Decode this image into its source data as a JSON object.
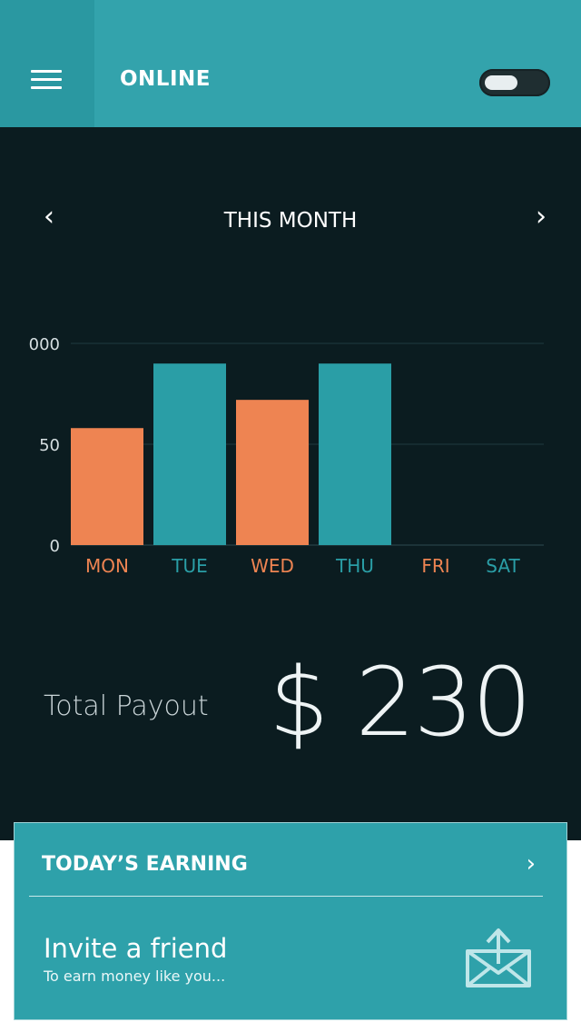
{
  "header": {
    "title": "ONLINE",
    "toggle_on": false
  },
  "period": {
    "title": "THIS MONTH"
  },
  "chart_data": {
    "type": "bar",
    "categories": [
      "MON",
      "TUE",
      "WED",
      "THU",
      "FRI",
      "SAT"
    ],
    "values": [
      58,
      90,
      72,
      90,
      0,
      0
    ],
    "bar_colors": [
      "#ee8452",
      "#2a9ea6",
      "#ee8452",
      "#2a9ea6",
      "#ee8452",
      "#2a9ea6"
    ],
    "ytick_labels": [
      "0",
      "50",
      "000"
    ],
    "ytick_values": [
      0,
      50,
      100
    ],
    "ylim": [
      0,
      100
    ],
    "grid": true,
    "title": "",
    "xlabel": "",
    "ylabel": ""
  },
  "total": {
    "label": "Total Payout",
    "amount": "$ 230"
  },
  "card": {
    "earning_title": "TODAY’S EARNING",
    "invite_title": "Invite a friend",
    "invite_subtitle": "To earn money like you..."
  },
  "colors": {
    "teal": "#33a3ac",
    "teal_dark": "#2a98a1",
    "background_dark": "#0b1c20",
    "orange": "#ee8452"
  },
  "icons": {
    "menu": "hamburger-menu-icon",
    "prev": "chevron-left-icon",
    "next": "chevron-right-icon",
    "earning": "chevron-right-icon",
    "invite": "mail-send-icon"
  }
}
